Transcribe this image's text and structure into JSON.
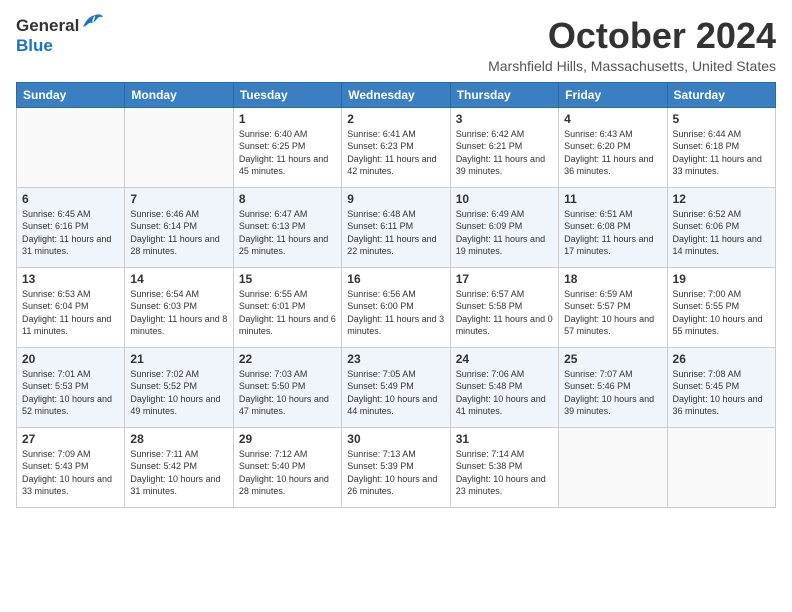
{
  "header": {
    "logo_general": "General",
    "logo_blue": "Blue",
    "month_title": "October 2024",
    "location": "Marshfield Hills, Massachusetts, United States"
  },
  "calendar": {
    "weekdays": [
      "Sunday",
      "Monday",
      "Tuesday",
      "Wednesday",
      "Thursday",
      "Friday",
      "Saturday"
    ],
    "weeks": [
      [
        {
          "day": "",
          "info": ""
        },
        {
          "day": "",
          "info": ""
        },
        {
          "day": "1",
          "info": "Sunrise: 6:40 AM\nSunset: 6:25 PM\nDaylight: 11 hours and 45 minutes."
        },
        {
          "day": "2",
          "info": "Sunrise: 6:41 AM\nSunset: 6:23 PM\nDaylight: 11 hours and 42 minutes."
        },
        {
          "day": "3",
          "info": "Sunrise: 6:42 AM\nSunset: 6:21 PM\nDaylight: 11 hours and 39 minutes."
        },
        {
          "day": "4",
          "info": "Sunrise: 6:43 AM\nSunset: 6:20 PM\nDaylight: 11 hours and 36 minutes."
        },
        {
          "day": "5",
          "info": "Sunrise: 6:44 AM\nSunset: 6:18 PM\nDaylight: 11 hours and 33 minutes."
        }
      ],
      [
        {
          "day": "6",
          "info": "Sunrise: 6:45 AM\nSunset: 6:16 PM\nDaylight: 11 hours and 31 minutes."
        },
        {
          "day": "7",
          "info": "Sunrise: 6:46 AM\nSunset: 6:14 PM\nDaylight: 11 hours and 28 minutes."
        },
        {
          "day": "8",
          "info": "Sunrise: 6:47 AM\nSunset: 6:13 PM\nDaylight: 11 hours and 25 minutes."
        },
        {
          "day": "9",
          "info": "Sunrise: 6:48 AM\nSunset: 6:11 PM\nDaylight: 11 hours and 22 minutes."
        },
        {
          "day": "10",
          "info": "Sunrise: 6:49 AM\nSunset: 6:09 PM\nDaylight: 11 hours and 19 minutes."
        },
        {
          "day": "11",
          "info": "Sunrise: 6:51 AM\nSunset: 6:08 PM\nDaylight: 11 hours and 17 minutes."
        },
        {
          "day": "12",
          "info": "Sunrise: 6:52 AM\nSunset: 6:06 PM\nDaylight: 11 hours and 14 minutes."
        }
      ],
      [
        {
          "day": "13",
          "info": "Sunrise: 6:53 AM\nSunset: 6:04 PM\nDaylight: 11 hours and 11 minutes."
        },
        {
          "day": "14",
          "info": "Sunrise: 6:54 AM\nSunset: 6:03 PM\nDaylight: 11 hours and 8 minutes."
        },
        {
          "day": "15",
          "info": "Sunrise: 6:55 AM\nSunset: 6:01 PM\nDaylight: 11 hours and 6 minutes."
        },
        {
          "day": "16",
          "info": "Sunrise: 6:56 AM\nSunset: 6:00 PM\nDaylight: 11 hours and 3 minutes."
        },
        {
          "day": "17",
          "info": "Sunrise: 6:57 AM\nSunset: 5:58 PM\nDaylight: 11 hours and 0 minutes."
        },
        {
          "day": "18",
          "info": "Sunrise: 6:59 AM\nSunset: 5:57 PM\nDaylight: 10 hours and 57 minutes."
        },
        {
          "day": "19",
          "info": "Sunrise: 7:00 AM\nSunset: 5:55 PM\nDaylight: 10 hours and 55 minutes."
        }
      ],
      [
        {
          "day": "20",
          "info": "Sunrise: 7:01 AM\nSunset: 5:53 PM\nDaylight: 10 hours and 52 minutes."
        },
        {
          "day": "21",
          "info": "Sunrise: 7:02 AM\nSunset: 5:52 PM\nDaylight: 10 hours and 49 minutes."
        },
        {
          "day": "22",
          "info": "Sunrise: 7:03 AM\nSunset: 5:50 PM\nDaylight: 10 hours and 47 minutes."
        },
        {
          "day": "23",
          "info": "Sunrise: 7:05 AM\nSunset: 5:49 PM\nDaylight: 10 hours and 44 minutes."
        },
        {
          "day": "24",
          "info": "Sunrise: 7:06 AM\nSunset: 5:48 PM\nDaylight: 10 hours and 41 minutes."
        },
        {
          "day": "25",
          "info": "Sunrise: 7:07 AM\nSunset: 5:46 PM\nDaylight: 10 hours and 39 minutes."
        },
        {
          "day": "26",
          "info": "Sunrise: 7:08 AM\nSunset: 5:45 PM\nDaylight: 10 hours and 36 minutes."
        }
      ],
      [
        {
          "day": "27",
          "info": "Sunrise: 7:09 AM\nSunset: 5:43 PM\nDaylight: 10 hours and 33 minutes."
        },
        {
          "day": "28",
          "info": "Sunrise: 7:11 AM\nSunset: 5:42 PM\nDaylight: 10 hours and 31 minutes."
        },
        {
          "day": "29",
          "info": "Sunrise: 7:12 AM\nSunset: 5:40 PM\nDaylight: 10 hours and 28 minutes."
        },
        {
          "day": "30",
          "info": "Sunrise: 7:13 AM\nSunset: 5:39 PM\nDaylight: 10 hours and 26 minutes."
        },
        {
          "day": "31",
          "info": "Sunrise: 7:14 AM\nSunset: 5:38 PM\nDaylight: 10 hours and 23 minutes."
        },
        {
          "day": "",
          "info": ""
        },
        {
          "day": "",
          "info": ""
        }
      ]
    ]
  }
}
